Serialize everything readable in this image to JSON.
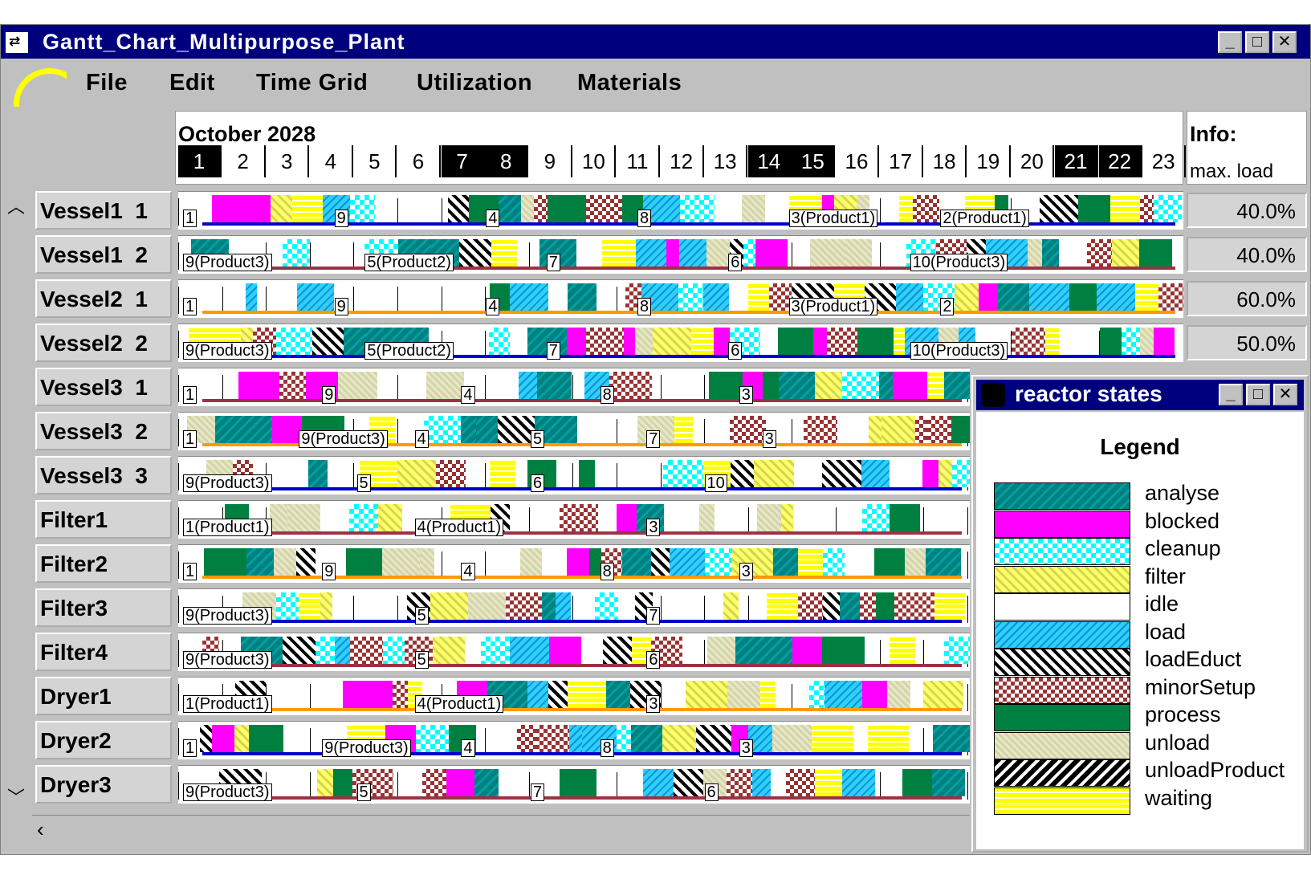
{
  "window": {
    "title": "Gantt_Chart_Multipurpose_Plant",
    "buttons": [
      "_",
      "□",
      "X"
    ]
  },
  "menu": [
    "File",
    "Edit",
    "Time Grid",
    "Utilization",
    "Materials"
  ],
  "timeline": {
    "month": "October  2028",
    "days": [
      {
        "d": "1",
        "we": true
      },
      {
        "d": "2",
        "we": false
      },
      {
        "d": "3",
        "we": false
      },
      {
        "d": "4",
        "we": false
      },
      {
        "d": "5",
        "we": false
      },
      {
        "d": "6",
        "we": false
      },
      {
        "d": "7",
        "we": true
      },
      {
        "d": "8",
        "we": true
      },
      {
        "d": "9",
        "we": false
      },
      {
        "d": "10",
        "we": false
      },
      {
        "d": "11",
        "we": false
      },
      {
        "d": "12",
        "we": false
      },
      {
        "d": "13",
        "we": false
      },
      {
        "d": "14",
        "we": true
      },
      {
        "d": "15",
        "we": true
      },
      {
        "d": "16",
        "we": false
      },
      {
        "d": "17",
        "we": false
      },
      {
        "d": "18",
        "we": false
      },
      {
        "d": "19",
        "we": false
      },
      {
        "d": "20",
        "we": false
      },
      {
        "d": "21",
        "we": true
      },
      {
        "d": "22",
        "we": true
      },
      {
        "d": "23",
        "we": false
      }
    ]
  },
  "info": {
    "title": "Info:",
    "subtitle": "max. load"
  },
  "rows": [
    {
      "name": "Vessel1  1",
      "load": "40.0%",
      "labels": [
        "1",
        "9",
        "4",
        "8",
        "3(Product1)",
        "2(Product1)"
      ]
    },
    {
      "name": "Vessel1  2",
      "load": "40.0%",
      "labels": [
        "9(Product3)",
        "5(Product2)",
        "7",
        "6",
        "10(Product3)"
      ]
    },
    {
      "name": "Vessel2  1",
      "load": "60.0%",
      "labels": [
        "1",
        "9",
        "4",
        "8",
        "3(Product1)",
        "2"
      ]
    },
    {
      "name": "Vessel2  2",
      "load": "50.0%",
      "labels": [
        "9(Product3)",
        "5(Product2)",
        "7",
        "6",
        "10(Product3)"
      ]
    },
    {
      "name": "Vessel3  1",
      "load": "",
      "labels": [
        "1",
        "9",
        "4",
        "8",
        "3"
      ]
    },
    {
      "name": "Vessel3  2",
      "load": "",
      "labels": [
        "1",
        "9(Product3)",
        "4",
        "5",
        "7",
        "3"
      ]
    },
    {
      "name": "Vessel3  3",
      "load": "",
      "labels": [
        "9(Product3)",
        "5",
        "6",
        "10"
      ]
    },
    {
      "name": "Filter1",
      "load": "",
      "labels": [
        "1(Product1)",
        "4(Product1)",
        "3"
      ]
    },
    {
      "name": "Filter2",
      "load": "",
      "labels": [
        "1",
        "9",
        "4",
        "8",
        "3"
      ]
    },
    {
      "name": "Filter3",
      "load": "",
      "labels": [
        "9(Product3)",
        "5",
        "7"
      ]
    },
    {
      "name": "Filter4",
      "load": "",
      "labels": [
        "9(Product3)",
        "5",
        "6"
      ]
    },
    {
      "name": "Dryer1",
      "load": "",
      "labels": [
        "1(Product1)",
        "4(Product1)",
        "3"
      ]
    },
    {
      "name": "Dryer2",
      "load": "",
      "labels": [
        "1",
        "9(Product3)",
        "4",
        "8",
        "3"
      ]
    },
    {
      "name": "Dryer3",
      "load": "",
      "labels": [
        "9(Product3)",
        "5",
        "7",
        "6"
      ]
    }
  ],
  "legend_window": {
    "title": "reactor states",
    "heading": "Legend",
    "items": [
      {
        "name": "analyse",
        "color": "#008080"
      },
      {
        "name": "blocked",
        "color": "#ff00ff"
      },
      {
        "name": "cleanup",
        "color": "#00ffff"
      },
      {
        "name": "filter",
        "color": "#ffff66"
      },
      {
        "name": "idle",
        "color": "#ffffff"
      },
      {
        "name": "load",
        "color": "#33ccff"
      },
      {
        "name": "loadEduct",
        "color": "#000000"
      },
      {
        "name": "minorSetup",
        "color": "#993333"
      },
      {
        "name": "process",
        "color": "#008040"
      },
      {
        "name": "unload",
        "color": "#d4d4aa"
      },
      {
        "name": "unloadProduct",
        "color": "#000000"
      },
      {
        "name": "waiting",
        "color": "#ffff00"
      }
    ]
  }
}
